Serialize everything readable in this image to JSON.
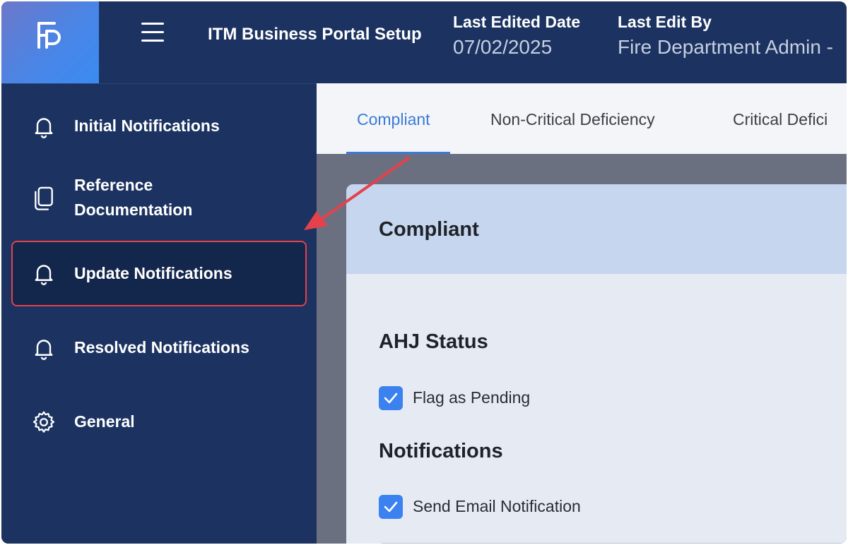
{
  "header": {
    "app_title": "ITM Business Portal Setup",
    "last_edited_date_label": "Last Edited Date",
    "last_edited_date_value": "07/02/2025",
    "last_edit_by_label": "Last Edit By",
    "last_edit_by_value": "Fire Department Admin -"
  },
  "sidebar": {
    "items": [
      {
        "label": "Initial Notifications",
        "icon": "bell-icon"
      },
      {
        "label": "Reference Documentation",
        "icon": "documents-icon"
      },
      {
        "label": "Update Notifications",
        "icon": "bell-icon",
        "active": true
      },
      {
        "label": "Resolved Notifications",
        "icon": "bell-icon"
      },
      {
        "label": "General",
        "icon": "gear-icon"
      }
    ],
    "reference_line1": "Reference",
    "reference_line2": "Documentation"
  },
  "tabs": [
    {
      "label": "Compliant",
      "active": true
    },
    {
      "label": "Non-Critical Deficiency"
    },
    {
      "label": "Critical Defici"
    }
  ],
  "card": {
    "title": "Compliant",
    "ahj_status_title": "AHJ Status",
    "flag_as_pending_label": "Flag as Pending",
    "flag_as_pending_checked": true,
    "notifications_title": "Notifications",
    "send_email_label": "Send Email Notification",
    "send_email_checked": true
  },
  "colors": {
    "navy": "#1c3361",
    "active_nav": "#13264c",
    "highlight_border": "#e5414b",
    "accent_blue": "#3b7bd6",
    "checkbox_blue": "#3b82f0"
  }
}
